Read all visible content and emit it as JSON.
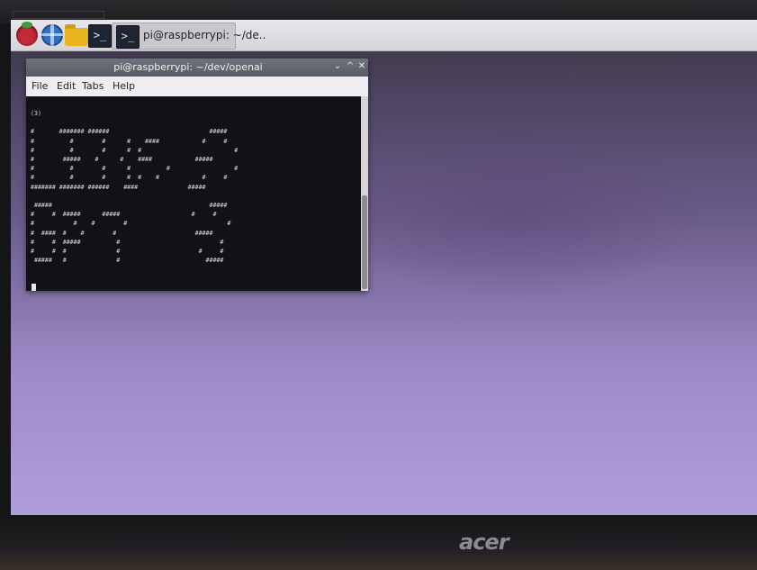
{
  "taskbar": {
    "task_label": "pi@raspberrypi: ~/de.."
  },
  "window": {
    "title": "pi@raspberrypi: ~/dev/openai",
    "controls": {
      "minimize": "⌄",
      "maximize": "^",
      "close": "✕"
    },
    "menu": [
      "File",
      "Edit",
      "Tabs",
      "Help"
    ]
  },
  "terminal": {
    "output": "(3)\n\n#       ####### ######                            #####\n#          #        #      #    ####            #     #\n#          #        #      #  #                          #\n#        #####    #      #    ####            #####\n#          #        #      #          #                  #\n#          #        #      #  #    #            #     #\n####### ####### ######    ####              #####\n\n #####                                            #####\n#     #  #####      #####                    #     #\n#           #    #        #                            #\n#  ####  #    #        #                      #####\n#     #  #####          #                            #\n#     #  #              #                      #     #\n #####   #              #                        #####"
  },
  "monitor": {
    "brand": "acer"
  }
}
